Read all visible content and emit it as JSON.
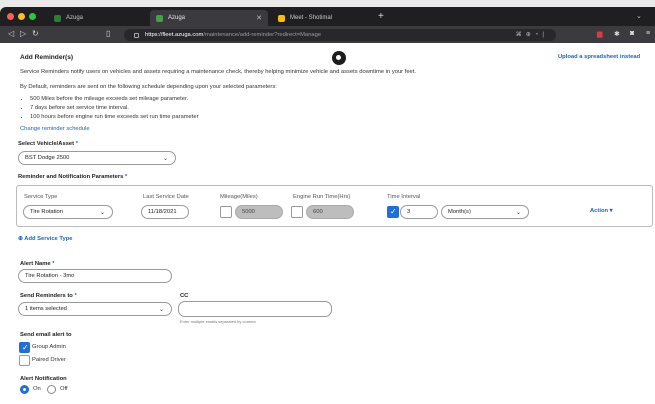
{
  "browser": {
    "tabs": [
      {
        "label": "Azuga",
        "active": false
      },
      {
        "label": "Azuga",
        "active": true
      },
      {
        "label": "Meet - Shotimal",
        "active": false
      }
    ],
    "url_host": "https://fleet.azuga.com",
    "url_path": "/maintenance/add-reminder?redirect=Manage"
  },
  "page": {
    "title": "Add Reminder(s)",
    "upload_link": "Upload a spreadsheet instead",
    "intro": "Service Reminders notify users on vehicles and assets requiring a maintenance check, thereby helping minimize vehicle and assets downtime in your feet.",
    "default_text": "By Default, reminders are sent on the following schedule depending upon your selected parameters:",
    "bullets": [
      "500 Miles before the mileage exceeds set mileage parameter.",
      "7 days before set service time interval.",
      "100 hours before engine run time exceeds set run time parameter"
    ],
    "change_schedule": "Change reminder schedule",
    "vehicle_label": "Select Vehicle/Asset",
    "required_mark": "*",
    "vehicle_value": "BST Dodge 2500",
    "params_label": "Reminder and Notification Parameters",
    "columns": {
      "service_type": "Service Type",
      "last_date": "Last Service Date",
      "mileage": "Mileage(Miles)",
      "engine": "Engine Run Time(Hrs)",
      "interval": "Time Interval"
    },
    "row": {
      "service_type": "Tire Rotation",
      "last_date": "11/18/2021",
      "mileage": "5000",
      "engine": "600",
      "interval_value": "3",
      "interval_unit": "Month(s)",
      "action": "Action ▾"
    },
    "add_service": "Add Service Type",
    "alert_name_label": "Alert Name",
    "alert_name_value": "Tire Rotation - 3mo",
    "send_to_label": "Send Reminders to",
    "send_to_value": "1 items selected",
    "cc_label": "CC",
    "cc_hint": "Enter multiple emails separated by comma",
    "email_label": "Send email alert to",
    "group_admin": "Group Admin",
    "paired_driver": "Paired Driver",
    "alert_notif_label": "Alert Notification",
    "on_label": "On",
    "off_label": "Off"
  },
  "colors": {
    "accent": "#1e6fd9",
    "link": "#1565c0"
  }
}
